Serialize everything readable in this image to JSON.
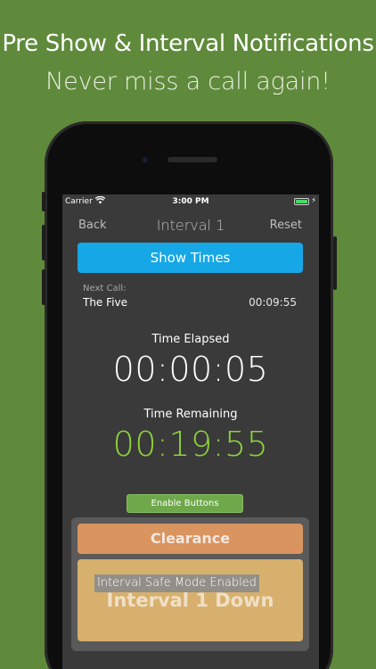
{
  "promo": {
    "headline": "Pre Show & Interval Notifications",
    "subheadline": "Never miss a call again!"
  },
  "status_bar": {
    "carrier": "Carrier",
    "time": "3:00 PM",
    "wifi_icon": "wifi-icon",
    "battery_icon": "battery-icon",
    "battery_level": 1.0,
    "battery_color": "#4cd964"
  },
  "nav": {
    "back": "Back",
    "title": "Interval 1",
    "reset": "Reset"
  },
  "show_times_button": "Show Times",
  "next_call": {
    "label": "Next Call:",
    "name": "The Five",
    "time": "00:09:55"
  },
  "elapsed": {
    "label": "Time Elapsed",
    "value": "00:00:05"
  },
  "remaining": {
    "label": "Time Remaining",
    "value": "00:19:55"
  },
  "enable_buttons": "Enable Buttons",
  "panel": {
    "clearance": "Clearance",
    "interval_down": "Interval 1 Down",
    "safe_mode": "Interval Safe Mode Enabled"
  },
  "colors": {
    "background": "#5f8a3b",
    "show_times": "#15a7e6",
    "remaining_green": "#8ed33b",
    "clearance": "#d99460",
    "interval_down": "#d8b06d",
    "enable_buttons": "#6ea84a"
  }
}
